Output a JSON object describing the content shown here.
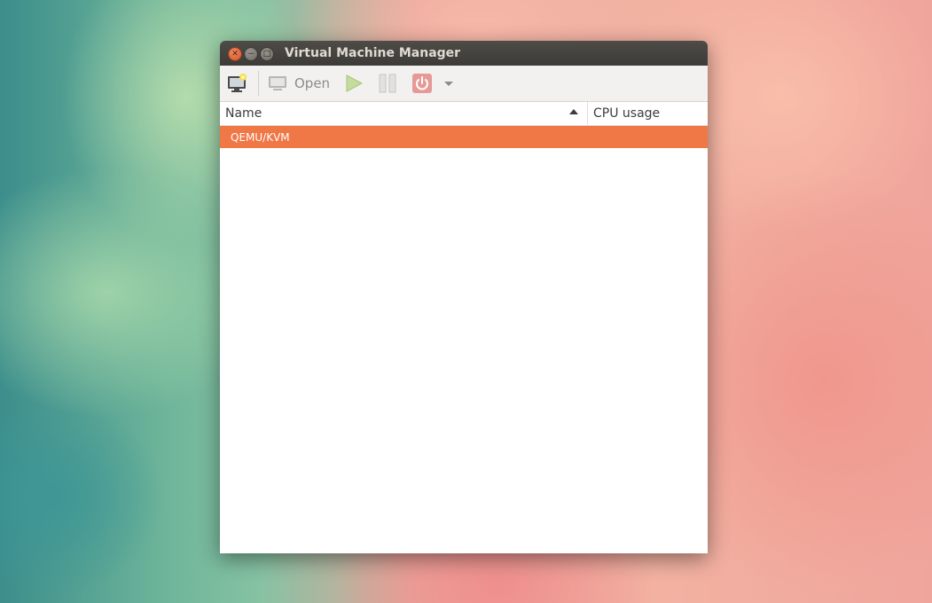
{
  "window": {
    "title": "Virtual Machine Manager"
  },
  "toolbar": {
    "new_vm_icon": "new-vm-icon",
    "open_label": "Open",
    "run_icon": "play-icon",
    "pause_icon": "pause-icon",
    "shutdown_icon": "power-icon",
    "menu_icon": "dropdown-arrow-icon"
  },
  "table": {
    "columns": [
      "Name",
      "CPU usage"
    ],
    "sort_column": "Name",
    "sort_direction": "ascending",
    "rows": [
      {
        "name": "QEMU/KVM",
        "selected": true
      }
    ]
  },
  "colors": {
    "selection": "#f07746",
    "titlebar": "#3c3b37",
    "close_button": "#e5622f"
  }
}
